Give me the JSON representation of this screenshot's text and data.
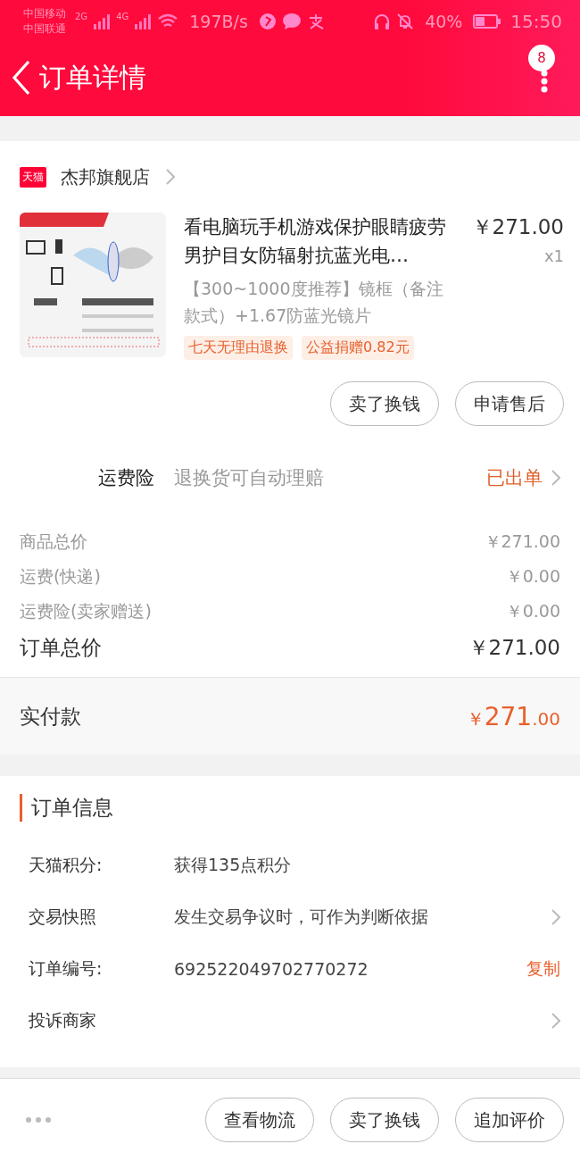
{
  "status_bar": {
    "carrier_1": "中国移动",
    "carrier_2": "中国联通",
    "net_1": "2G",
    "net_2": "4G",
    "speed": "197B/s",
    "battery": "40%",
    "time": "15:50"
  },
  "header": {
    "title": "订单详情",
    "badge": "8"
  },
  "store": {
    "badge": "天猫",
    "name": "杰邦旗舰店"
  },
  "product": {
    "kind": "picture",
    "title": "看电脑玩手机游戏保护眼睛疲劳男护目女防辐射抗蓝光电…",
    "price": "￥271.00",
    "quantity": "x1",
    "spec": "【300~1000度推荐】镜框（备注款式）+1.67防蓝光镜片",
    "tags": [
      "七天无理由退换",
      "公益捐赠0.82元"
    ]
  },
  "item_buttons": [
    "卖了换钱",
    "申请售后"
  ],
  "insurance": {
    "label": "运费险",
    "desc": "退换货可自动理赔",
    "status": "已出单"
  },
  "costs": [
    {
      "label": "商品总价",
      "value": "￥271.00",
      "kind": "minor"
    },
    {
      "label": "运费(快递)",
      "value": "￥0.00",
      "kind": "minor"
    },
    {
      "label": "运费险(卖家赠送)",
      "value": "￥0.00",
      "kind": "minor"
    },
    {
      "label": "订单总价",
      "value": "￥271.00",
      "kind": "total"
    }
  ],
  "payment": {
    "label": "实付款",
    "currency": "￥",
    "amount": "271",
    "cents": ".00"
  },
  "order_info": {
    "title": "订单信息",
    "rows": [
      {
        "label": "天猫积分:",
        "value": "获得135点积分",
        "kind": "plain"
      },
      {
        "label": "交易快照",
        "value": "发生交易争议时，可作为判断依据",
        "kind": "arrow"
      },
      {
        "label": "订单编号:",
        "value": "692522049702770272",
        "kind": "copy",
        "action_text": "复制"
      },
      {
        "label": "投诉商家",
        "kind": "arrow"
      }
    ]
  },
  "bottom_buttons": [
    "查看物流",
    "卖了换钱",
    "追加评价"
  ]
}
